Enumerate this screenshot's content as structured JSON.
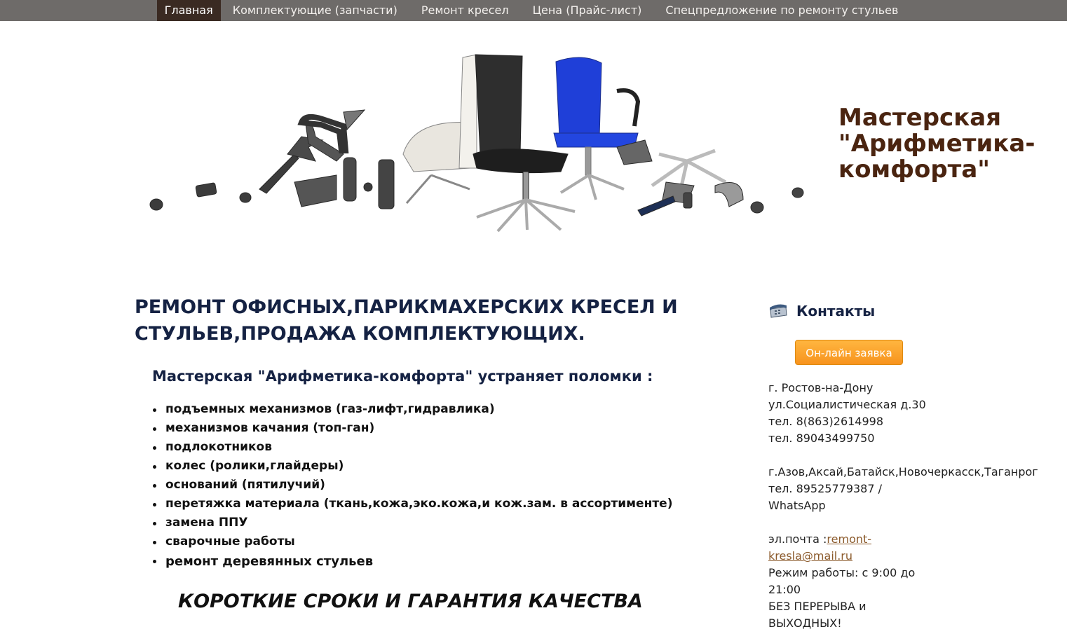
{
  "nav": {
    "items": [
      {
        "label": "Главная",
        "active": true
      },
      {
        "label": "Комплектующие (запчасти)",
        "active": false
      },
      {
        "label": "Ремонт кресел",
        "active": false
      },
      {
        "label": "Цена (Прайс-лист)",
        "active": false
      },
      {
        "label": "Спецпредложение по ремонту стульев",
        "active": false
      }
    ]
  },
  "header": {
    "title_line1": "Мастерская",
    "title_line2": "\"Арифметика-",
    "title_line3": "комфорта\""
  },
  "main": {
    "heading_line1": "РЕМОНТ ОФИСНЫХ,ПАРИКМАХЕРСКИХ КРЕСЕЛ И",
    "heading_line2": "СТУЛЬЕВ,ПРОДАЖА КОМПЛЕКТУЮЩИХ.",
    "subheading": "Мастерская \"Арифметика-комфорта\" устраняет поломки :",
    "services": [
      "подъемных механизмов (газ-лифт,гидравлика)",
      "механизмов качания (топ-ган)",
      "подлокотников",
      "колес (ролики,глайдеры)",
      "оснований (пятилучий)",
      "перетяжка материала (ткань,кожа,эко.кожа,и кож.зам. в ассортименте)",
      "замена ППУ",
      "сварочные работы",
      "ремонт деревянных стульев"
    ],
    "slogan": "КОРОТКИЕ СРОКИ И ГАРАНТИЯ КАЧЕСТВА"
  },
  "sidebar": {
    "contacts_title": "Контакты",
    "order_button": "Он-лайн заявка",
    "city": "г. Ростов-на-Дону",
    "street": "ул.Социалистическая д.30",
    "phone1": "тел. 8(863)2614998",
    "phone2": "тел. 89043499750",
    "cities": "г.Азов,Аксай,Батайск,Новочеркасск,Таганрог",
    "phone3": "тел. 89525779387  /",
    "messenger": "WhatsApp",
    "email_label": "эл.почта :",
    "email_part1": "remont-",
    "email_part2": "kresla@mail.ru",
    "hours_line1": "Режим работы: с 9:00 до",
    "hours_line2": "21:00",
    "break_line1": "БЕЗ ПЕРЕРЫВА и",
    "break_line2": "ВЫХОДНЫХ!"
  },
  "colors": {
    "nav_bg": "#6e6b69",
    "nav_active": "#3a2a22",
    "title": "#4a2410",
    "heading": "#152243",
    "button": "#f7931e",
    "link": "#8b5a2b"
  }
}
